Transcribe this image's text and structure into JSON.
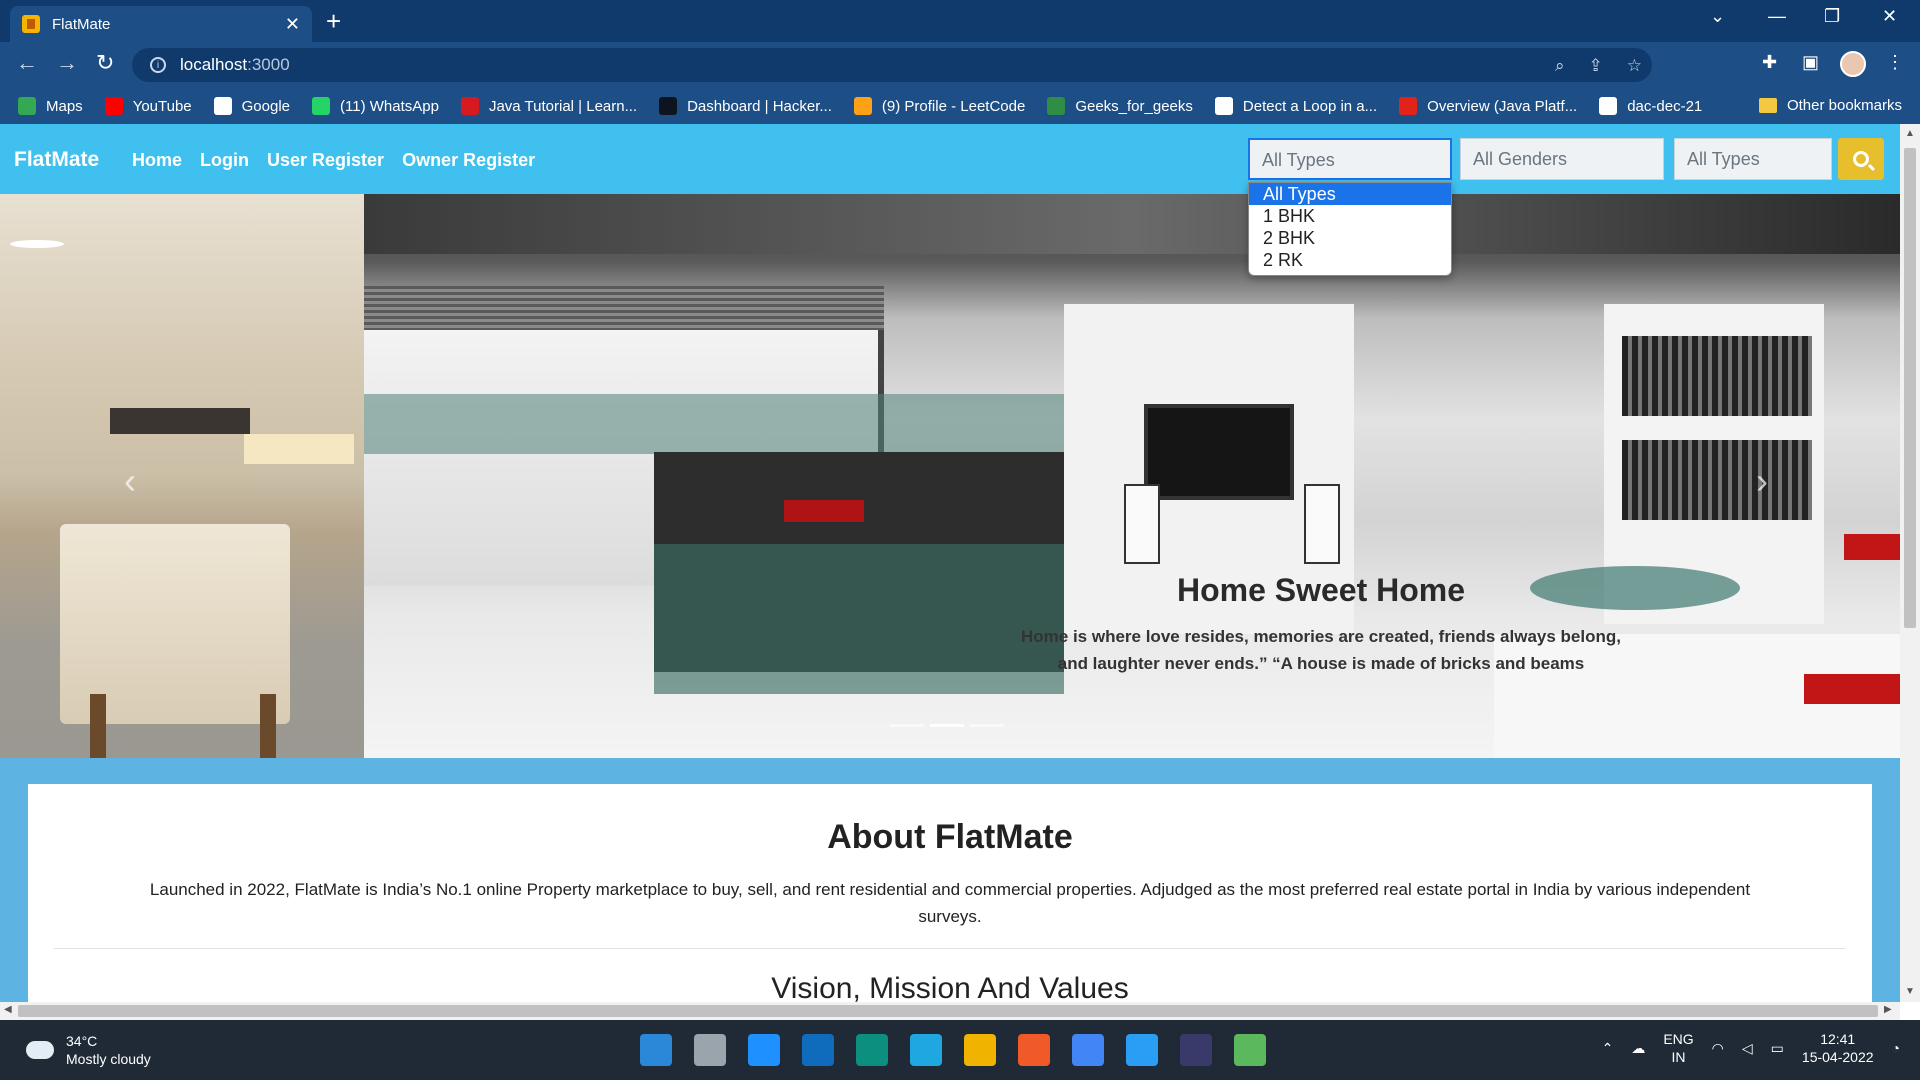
{
  "browser": {
    "tab_title": "FlatMate",
    "url_host": "localhost",
    "url_port": ":3000",
    "bookmarks": [
      {
        "label": "Maps",
        "color": "#34a853"
      },
      {
        "label": "YouTube",
        "color": "#ff0000"
      },
      {
        "label": "Google",
        "color": "#ffffff"
      },
      {
        "label": "(11) WhatsApp",
        "color": "#25d366"
      },
      {
        "label": "Java Tutorial | Learn...",
        "color": "#d71920"
      },
      {
        "label": "Dashboard | Hacker...",
        "color": "#0e141e"
      },
      {
        "label": "(9) Profile - LeetCode",
        "color": "#ffa116"
      },
      {
        "label": "Geeks_for_geeks",
        "color": "#2f8d46"
      },
      {
        "label": "Detect a Loop in a...",
        "color": "#ffffff"
      },
      {
        "label": "Overview (Java Platf...",
        "color": "#e2231a"
      },
      {
        "label": "dac-dec-21",
        "color": "#ffffff"
      }
    ],
    "other_bookmarks": "Other bookmarks"
  },
  "navbar": {
    "brand": "FlatMate",
    "links": [
      "Home",
      "Login",
      "User Register",
      "Owner Register"
    ],
    "filter_type": "All Types",
    "filter_gender": "All Genders",
    "filter_type2": "All Types",
    "dropdown_options": [
      "All Types",
      "1 BHK",
      "2 BHK",
      "2 RK"
    ]
  },
  "carousel": {
    "caption_title": "Home Sweet Home",
    "caption_text_line1": "Home is where love resides, memories are created, friends always belong,",
    "caption_text_line2": "and laughter never ends.” “A house is made of bricks and beams"
  },
  "about": {
    "title": "About FlatMate",
    "description": "Launched in 2022, FlatMate is India’s No.1 online Property marketplace to buy, sell, and rent residential and commercial properties. Adjudged as the most preferred real estate portal in India by various independent surveys.",
    "subtitle": "Vision, Mission And Values"
  },
  "taskbar": {
    "temperature": "34°C",
    "weather": "Mostly cloudy",
    "language_top": "ENG",
    "language_bottom": "IN",
    "time": "12:41",
    "date": "15-04-2022",
    "app_colors": [
      "#2b88d8",
      "#9aa4ad",
      "#1e90ff",
      "#0f6cbd",
      "#0c8f7e",
      "#1ea7e1",
      "#f0b400",
      "#f05a28",
      "#4285f4",
      "#2a9df4",
      "#3a3a6a",
      "#5cb85c"
    ]
  }
}
